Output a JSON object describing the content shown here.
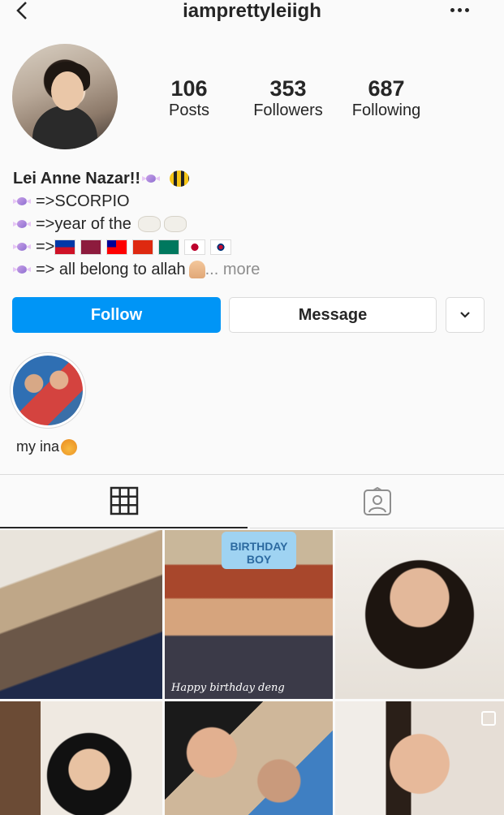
{
  "header": {
    "username": "iamprettyleiigh"
  },
  "stats": [
    {
      "count": "106",
      "label": "Posts"
    },
    {
      "count": "353",
      "label": "Followers"
    },
    {
      "count": "687",
      "label": "Following"
    }
  ],
  "bio": {
    "name": "Lei Anne Nazar!!",
    "lines": [
      "=>SCORPIO",
      "=>year of the",
      "=>",
      "=> all belong to allah"
    ],
    "more": "... more"
  },
  "actions": {
    "follow": "Follow",
    "message": "Message"
  },
  "highlights": [
    {
      "label": "my ina"
    }
  ],
  "posts": [
    {
      "overlay": ""
    },
    {
      "overlay": "BIRTHDAY BOY",
      "caption": "Happy birthday deng"
    },
    {
      "overlay": ""
    },
    {
      "overlay": ""
    },
    {
      "overlay": ""
    },
    {
      "overlay": ""
    }
  ],
  "colors": {
    "primary_button": "#0095f6",
    "text": "#262626",
    "muted": "#8e8e8e",
    "border": "#dbdbdb"
  },
  "icons": [
    "back-arrow-icon",
    "more-options-icon",
    "candy-icon",
    "bee-icon",
    "sheep-icon",
    "folded-hands-icon",
    "chevron-down-icon",
    "grid-icon",
    "tagged-icon",
    "multi-post-icon"
  ]
}
